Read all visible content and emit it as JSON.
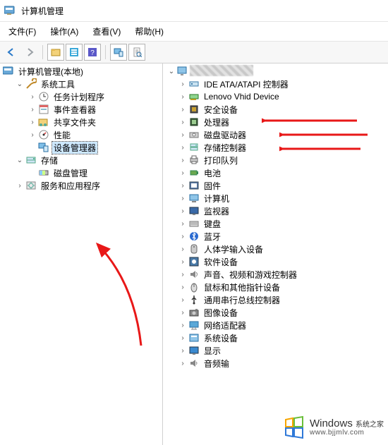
{
  "window": {
    "title": "计算机管理"
  },
  "menu": {
    "file": "文件(F)",
    "action": "操作(A)",
    "view": "查看(V)",
    "help": "帮助(H)"
  },
  "left_tree": {
    "root": "计算机管理(本地)",
    "system_tools": "系统工具",
    "task_scheduler": "任务计划程序",
    "event_viewer": "事件查看器",
    "shared_folders": "共享文件夹",
    "performance": "性能",
    "device_manager": "设备管理器",
    "storage": "存储",
    "disk_management": "磁盘管理",
    "services_apps": "服务和应用程序"
  },
  "right_tree": {
    "computer_name": "",
    "items": [
      {
        "label": "IDE ATA/ATAPI 控制器",
        "icon": "ide"
      },
      {
        "label": "Lenovo Vhid Device",
        "icon": "pci"
      },
      {
        "label": "安全设备",
        "icon": "security"
      },
      {
        "label": "处理器",
        "icon": "cpu"
      },
      {
        "label": "磁盘驱动器",
        "icon": "disk"
      },
      {
        "label": "存储控制器",
        "icon": "storage"
      },
      {
        "label": "打印队列",
        "icon": "printer"
      },
      {
        "label": "电池",
        "icon": "battery"
      },
      {
        "label": "固件",
        "icon": "firmware"
      },
      {
        "label": "计算机",
        "icon": "computer"
      },
      {
        "label": "监视器",
        "icon": "monitor"
      },
      {
        "label": "键盘",
        "icon": "keyboard"
      },
      {
        "label": "蓝牙",
        "icon": "bluetooth"
      },
      {
        "label": "人体学输入设备",
        "icon": "hid"
      },
      {
        "label": "软件设备",
        "icon": "software"
      },
      {
        "label": "声音、视频和游戏控制器",
        "icon": "sound"
      },
      {
        "label": "鼠标和其他指针设备",
        "icon": "mouse"
      },
      {
        "label": "通用串行总线控制器",
        "icon": "usb"
      },
      {
        "label": "图像设备",
        "icon": "camera"
      },
      {
        "label": "网络适配器",
        "icon": "network"
      },
      {
        "label": "系统设备",
        "icon": "system"
      },
      {
        "label": "显示",
        "icon": "display",
        "truncated": true
      },
      {
        "label": "音频输",
        "icon": "audio",
        "truncated": true
      }
    ]
  },
  "watermark": {
    "brand_en": "Windows",
    "brand_cn": "系统之家",
    "url": "www.bjjmlv.com"
  },
  "arrow_targets_indices": [
    3,
    4,
    5
  ]
}
